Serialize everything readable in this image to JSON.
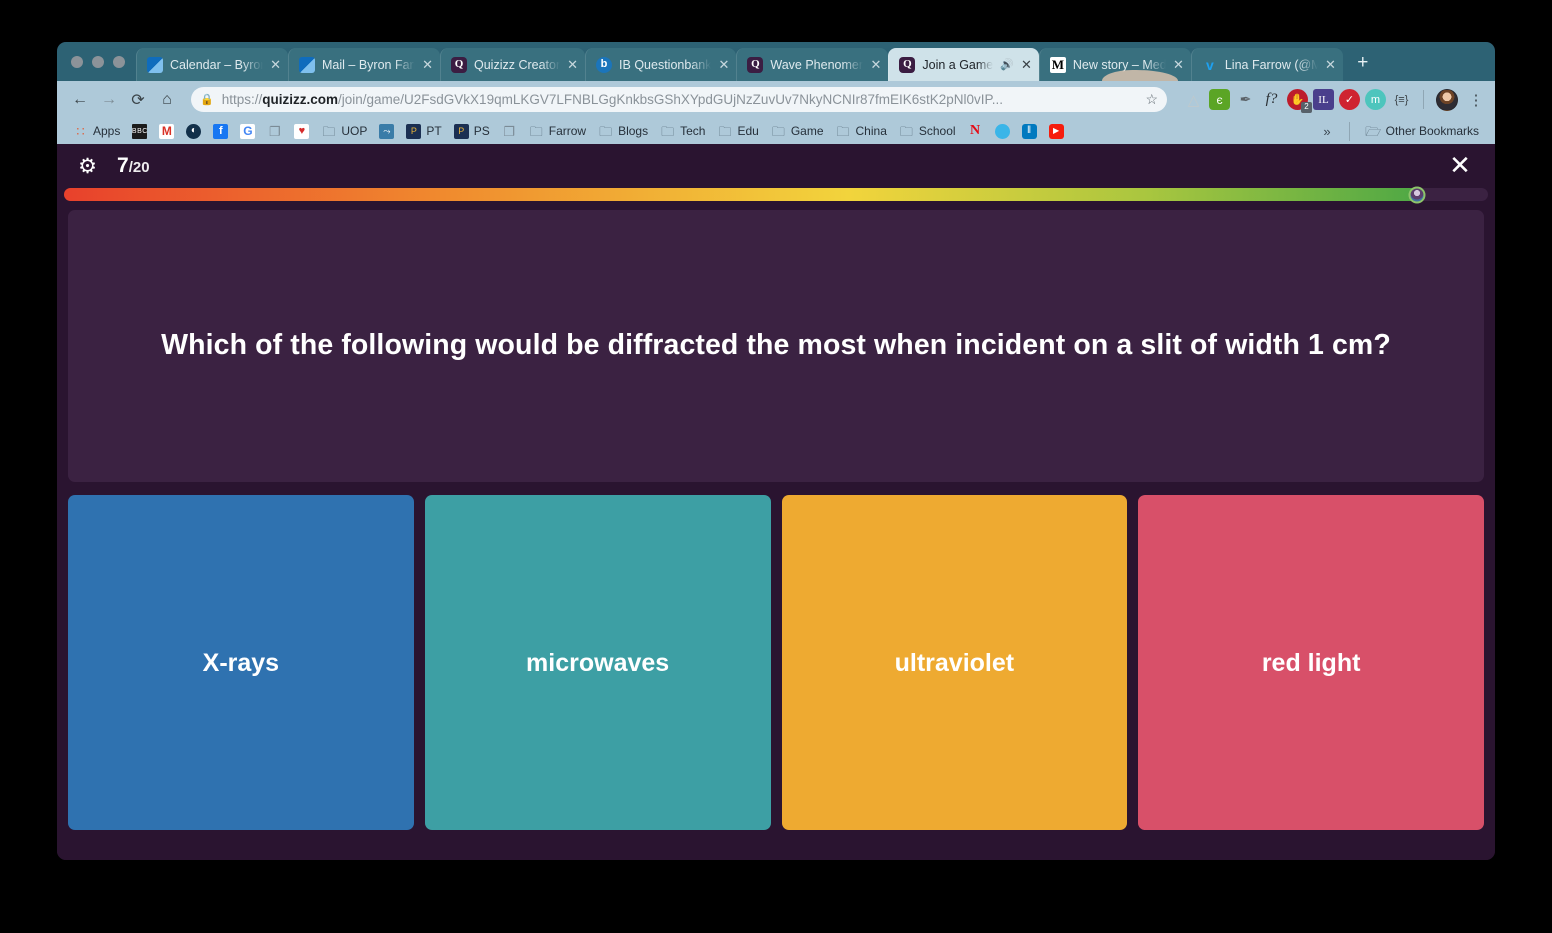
{
  "browser": {
    "traffic_lights": [
      "close",
      "minimize",
      "maximize"
    ],
    "tabs": [
      {
        "title": "Calendar – Byron Farrow",
        "favicon": "outlook-icon",
        "active": false,
        "audio": false
      },
      {
        "title": "Mail – Byron Farrow",
        "favicon": "outlook-icon",
        "active": false,
        "audio": false
      },
      {
        "title": "Quizizz Creator",
        "favicon": "quizizz-icon",
        "active": false,
        "audio": false
      },
      {
        "title": "IB Questionbank",
        "favicon": "ib-icon",
        "active": false,
        "audio": false
      },
      {
        "title": "Wave Phenomena",
        "favicon": "quizizz-icon",
        "active": false,
        "audio": false
      },
      {
        "title": "Join a Game",
        "favicon": "quizizz-icon",
        "active": true,
        "audio": true
      },
      {
        "title": "New story – Medium",
        "favicon": "medium-icon",
        "active": false,
        "audio": false
      },
      {
        "title": "Lina Farrow (@Mrs...",
        "favicon": "twitter-icon",
        "active": false,
        "audio": false
      }
    ],
    "new_tab_label": "+",
    "close_label": "✕",
    "sound_label": "🔊",
    "nav": {
      "back": "←",
      "forward": "→",
      "reload": "⟳",
      "home": "⌂"
    },
    "omnibox": {
      "lock": "🔒",
      "url_scheme": "https://",
      "url_domain": "quizizz.com",
      "url_path": "/join/game/U2FsdGVkX19qmLKGV7LFNBLGgKnkbsGShXYpdGUjNzZuvUv7NkyNCNIr87fmEIK6stK2pNl0vIP...",
      "star": "☆"
    },
    "extensions": [
      {
        "name": "google-drive-icon",
        "glyph": "△"
      },
      {
        "name": "evernote-icon",
        "glyph": "є"
      },
      {
        "name": "eyedropper-icon",
        "glyph": "✒"
      },
      {
        "name": "fontface-icon",
        "glyph": "f?"
      },
      {
        "name": "hypothesis-icon",
        "glyph": "✋",
        "badge": "2"
      },
      {
        "name": "illustrator-icon",
        "glyph": "IL"
      },
      {
        "name": "grammarly-icon",
        "glyph": "✓"
      },
      {
        "name": "momentum-icon",
        "glyph": "m"
      },
      {
        "name": "readability-icon",
        "glyph": "{≡}"
      }
    ],
    "profile_avatar": "avatar",
    "menu": "⋮",
    "bookmarks": [
      {
        "label": "Apps",
        "icon": "apps-grid-icon",
        "icon_class": "i-apps",
        "glyph": "∷"
      },
      {
        "label": "",
        "icon": "bbc-icon",
        "icon_class": "i-bbc",
        "glyph": "BBC"
      },
      {
        "label": "",
        "icon": "gmail-icon",
        "icon_class": "i-gmail",
        "glyph": "M"
      },
      {
        "label": "",
        "icon": "opera-icon",
        "icon_class": "i-oval",
        "glyph": "◐"
      },
      {
        "label": "",
        "icon": "facebook-icon",
        "icon_class": "i-fb",
        "glyph": "f"
      },
      {
        "label": "",
        "icon": "google-icon",
        "icon_class": "i-google",
        "glyph": "G"
      },
      {
        "label": "",
        "icon": "page-icon",
        "icon_class": "i-doc",
        "glyph": "❐"
      },
      {
        "label": "",
        "icon": "vee-icon",
        "icon_class": "i-vee",
        "glyph": "♥"
      },
      {
        "label": "UOP",
        "icon": "folder-icon",
        "icon_class": "i-folder",
        "glyph": "🗀"
      },
      {
        "label": "",
        "icon": "shortcut-icon",
        "icon_class": "i-uop",
        "glyph": "⤳"
      },
      {
        "label": "PT",
        "icon": "pdf-icon",
        "icon_class": "i-pj",
        "glyph": "P"
      },
      {
        "label": "PS",
        "icon": "pdf-icon",
        "icon_class": "i-pj",
        "glyph": "P"
      },
      {
        "label": "",
        "icon": "page-icon",
        "icon_class": "i-doc",
        "glyph": "❐"
      },
      {
        "label": "Farrow",
        "icon": "folder-icon",
        "icon_class": "i-folder",
        "glyph": "🗀"
      },
      {
        "label": "Blogs",
        "icon": "folder-icon",
        "icon_class": "i-folder",
        "glyph": "🗀"
      },
      {
        "label": "Tech",
        "icon": "folder-icon",
        "icon_class": "i-folder",
        "glyph": "🗀"
      },
      {
        "label": "Edu",
        "icon": "folder-icon",
        "icon_class": "i-folder",
        "glyph": "🗀"
      },
      {
        "label": "Game",
        "icon": "folder-icon",
        "icon_class": "i-folder",
        "glyph": "🗀"
      },
      {
        "label": "China",
        "icon": "folder-icon",
        "icon_class": "i-folder",
        "glyph": "🗀"
      },
      {
        "label": "School",
        "icon": "folder-icon",
        "icon_class": "i-folder",
        "glyph": "🗀"
      },
      {
        "label": "",
        "icon": "netflix-icon",
        "icon_class": "i-netflix",
        "glyph": "N"
      },
      {
        "label": "",
        "icon": "bluedot-icon",
        "icon_class": "i-bluedot",
        "glyph": ""
      },
      {
        "label": "",
        "icon": "trello-icon",
        "icon_class": "i-trello",
        "glyph": "‖"
      },
      {
        "label": "",
        "icon": "youtube-icon",
        "icon_class": "i-youtube",
        "glyph": "▶"
      }
    ],
    "bookmarks_overflow": "»",
    "other_bookmarks": "Other Bookmarks"
  },
  "quiz": {
    "settings_icon": "⚙",
    "close_icon": "✕",
    "current_question": "7",
    "total_questions": "/20",
    "progress_percent": 95,
    "question": "Which of the following would be diffracted the most when incident on a slit of width 1 cm?",
    "options": [
      {
        "label": "X-rays",
        "color": "#2f72b0"
      },
      {
        "label": "microwaves",
        "color": "#3d9fa4"
      },
      {
        "label": "ultraviolet",
        "color": "#eeaa31"
      },
      {
        "label": "red light",
        "color": "#d85069"
      }
    ],
    "theme": {
      "background": "#2a1430",
      "card": "#3b2242",
      "progress_gradient_start": "#e8412c",
      "progress_gradient_mid": "#f2d43c",
      "progress_gradient_end": "#4fa845"
    }
  }
}
